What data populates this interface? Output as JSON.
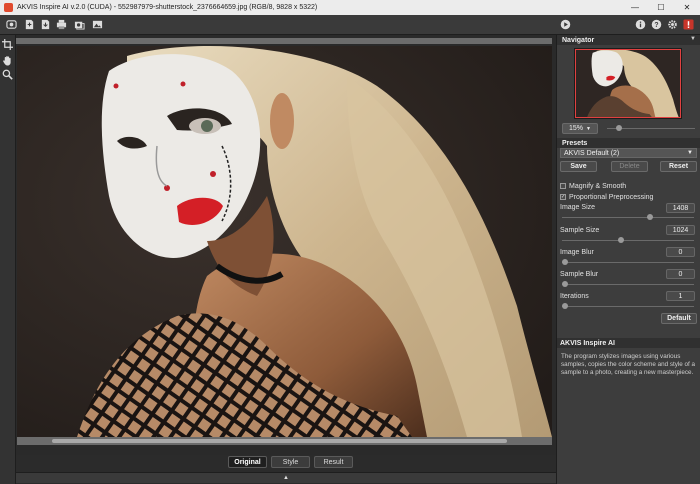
{
  "window": {
    "title": "AKVIS Inspire AI v.2.0 (CUDA) - 552987979-shutterstock_2376664659.jpg (RGB/8, 9828 x 5322)",
    "minimize": "—",
    "maximize": "☐",
    "close": "✕"
  },
  "toolbar": {
    "icons": [
      "home-icon",
      "open-file-icon",
      "save-file-icon",
      "print-icon",
      "batch-icon",
      "image-icon"
    ],
    "right_icons": [
      "run-icon",
      "info-icon",
      "help-icon",
      "settings-icon",
      "notifications-icon"
    ],
    "accent": "#e04a2e"
  },
  "tools": [
    "crop-icon",
    "hand-icon",
    "zoom-icon"
  ],
  "view_tabs": {
    "original": "Original",
    "style": "Style",
    "result": "Result",
    "active": "Original"
  },
  "collapse_arrow": "▲",
  "navigator": {
    "title": "Navigator",
    "zoom": "15%",
    "zoom_level": 0.07
  },
  "presets": {
    "title": "Presets",
    "selected": "AKVIS Default (2)",
    "save": "Save",
    "delete": "Delete",
    "reset": "Reset"
  },
  "options": {
    "magnify_smooth": {
      "label": "Magnify & Smooth",
      "checked": false
    },
    "proportional": {
      "label": "Proportional Preprocessing",
      "checked": true
    }
  },
  "params": {
    "image_size": {
      "label": "Image Size",
      "value": "1408",
      "level": 0.89
    },
    "sample_size": {
      "label": "Sample Size",
      "value": "1024",
      "level": 0.43
    },
    "image_blur": {
      "label": "Image Blur",
      "value": "0",
      "level": 0
    },
    "sample_blur": {
      "label": "Sample Blur",
      "value": "0",
      "level": 0
    },
    "iterations": {
      "label": "Iterations",
      "value": "1",
      "level": 0
    }
  },
  "default_btn": "Default",
  "help": {
    "title": "AKVIS Inspire AI",
    "text": "The program stylizes images using various samples, copies the color scheme and style of a sample to a photo, creating a new masterpiece."
  }
}
